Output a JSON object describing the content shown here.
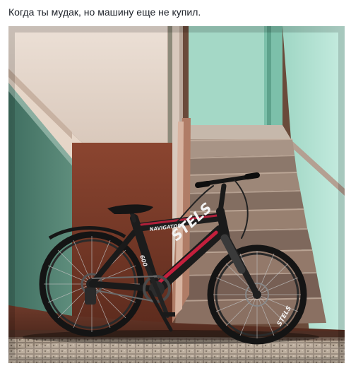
{
  "post": {
    "caption": "Когда ты мудак, но машину еще не купил."
  },
  "photo": {
    "frame_brand": "STELS",
    "frame_model": "NAVIGATOR",
    "down_tube_text": "600",
    "rim_brand": "STELS"
  }
}
